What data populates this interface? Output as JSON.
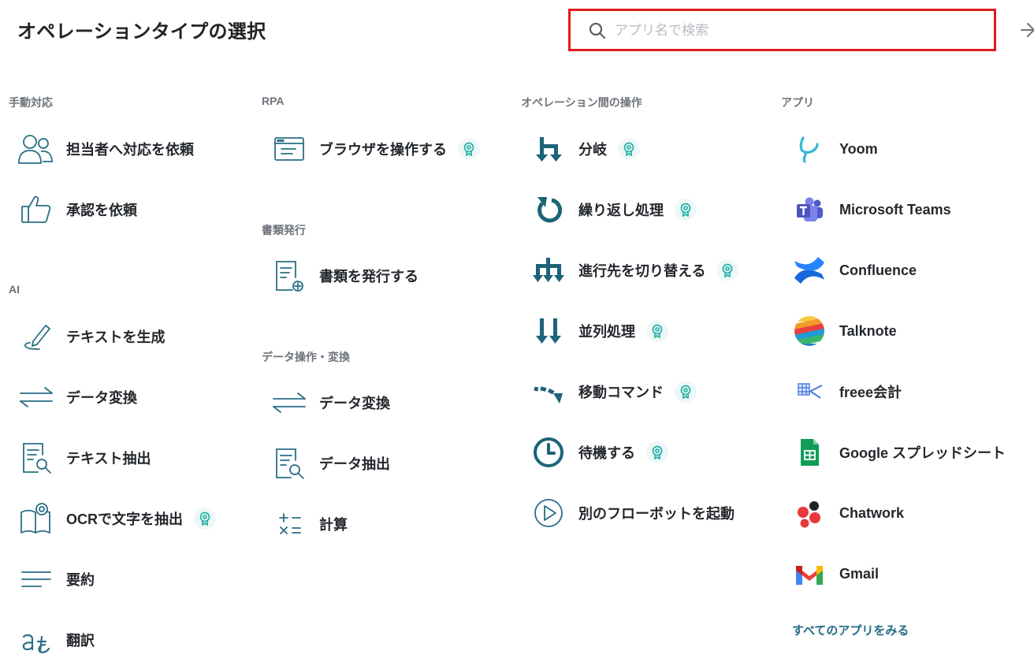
{
  "header": {
    "title": "オペレーションタイプの選択"
  },
  "search": {
    "placeholder": "アプリ名で検索",
    "value": ""
  },
  "columns": {
    "manual": {
      "label": "手動対応",
      "items": [
        {
          "label": "担当者へ対応を依頼",
          "icon": "people-icon"
        },
        {
          "label": "承認を依頼",
          "icon": "thumbs-up-icon"
        }
      ]
    },
    "ai": {
      "label": "AI",
      "items": [
        {
          "label": "テキストを生成",
          "icon": "pen-icon"
        },
        {
          "label": "データ変換",
          "icon": "arrows-exchange-icon"
        },
        {
          "label": "テキスト抽出",
          "icon": "document-search-icon"
        },
        {
          "label": "OCRで文字を抽出",
          "icon": "book-badge-icon",
          "badge": true
        },
        {
          "label": "要約",
          "icon": "lines-icon"
        },
        {
          "label": "翻訳",
          "icon": "translate-icon"
        }
      ]
    },
    "rpa": {
      "label": "RPA",
      "items": [
        {
          "label": "ブラウザを操作する",
          "icon": "browser-window-icon",
          "badge": true
        }
      ]
    },
    "documents": {
      "label": "書類発行",
      "items": [
        {
          "label": "書類を発行する",
          "icon": "document-add-icon"
        }
      ]
    },
    "data_ops": {
      "label": "データ操作・変換",
      "items": [
        {
          "label": "データ変換",
          "icon": "arrows-exchange-icon"
        },
        {
          "label": "データ抽出",
          "icon": "document-search-icon"
        },
        {
          "label": "計算",
          "icon": "math-operators-icon"
        }
      ]
    },
    "flow": {
      "label": "オペレーション間の操作",
      "items": [
        {
          "label": "分岐",
          "icon": "branch-icon",
          "badge": true
        },
        {
          "label": "繰り返し処理",
          "icon": "loop-icon",
          "badge": true
        },
        {
          "label": "進行先を切り替える",
          "icon": "switch-path-icon",
          "badge": true
        },
        {
          "label": "並列処理",
          "icon": "parallel-arrows-icon",
          "badge": true
        },
        {
          "label": "移動コマンド",
          "icon": "move-arrow-icon",
          "badge": true
        },
        {
          "label": "待機する",
          "icon": "clock-icon",
          "badge": true
        },
        {
          "label": "別のフローボットを起動",
          "icon": "play-circle-icon"
        }
      ]
    },
    "apps": {
      "label": "アプリ",
      "items": [
        {
          "label": "Yoom",
          "icon": "yoom-logo-icon"
        },
        {
          "label": "Microsoft Teams",
          "icon": "teams-logo-icon"
        },
        {
          "label": "Confluence",
          "icon": "confluence-logo-icon"
        },
        {
          "label": "Talknote",
          "icon": "talknote-logo-icon"
        },
        {
          "label": "freee会計",
          "icon": "freee-logo-icon"
        },
        {
          "label": "Google スプレッドシート",
          "icon": "sheets-logo-icon"
        },
        {
          "label": "Chatwork",
          "icon": "chatwork-logo-icon"
        },
        {
          "label": "Gmail",
          "icon": "gmail-logo-icon"
        }
      ],
      "see_all": "すべてのアプリをみる"
    }
  },
  "colors": {
    "accent": "#2a6f86",
    "teal_dark": "#1d6379",
    "badge_bg": "#eef8f7",
    "badge_fg": "#2ab2a8",
    "search_border": "#e01c1c"
  }
}
